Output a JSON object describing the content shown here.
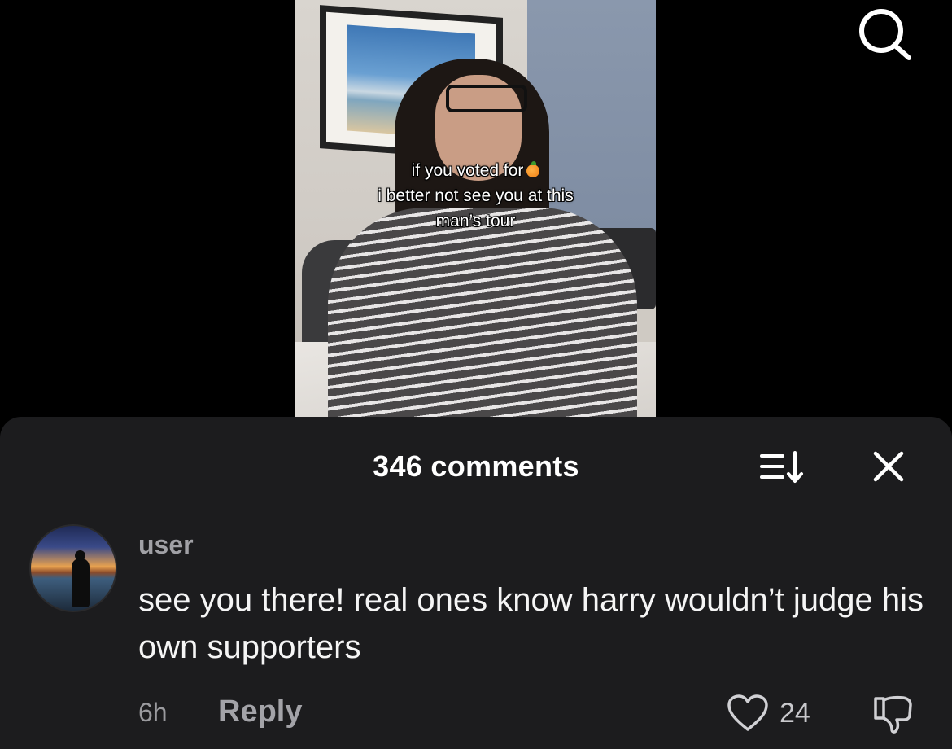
{
  "video": {
    "caption_line1": "if you voted for",
    "caption_emoji": "orange-emoji",
    "caption_line2": "i better not see you at this",
    "caption_line3": "man’s tour"
  },
  "header": {
    "search_icon": "search-icon"
  },
  "comments_panel": {
    "title": "346 comments",
    "sort_icon": "sort-icon",
    "close_icon": "close-icon"
  },
  "comment": {
    "username": "user",
    "text": "see you there! real ones know harry wouldn’t judge his own supporters",
    "time": "6h",
    "reply_label": "Reply",
    "like_count": "24",
    "like_icon": "heart-icon",
    "dislike_icon": "thumbs-down-icon"
  },
  "colors": {
    "background": "#000000",
    "sheet": "#1c1c1e",
    "secondary_text": "#9a9a9e"
  }
}
